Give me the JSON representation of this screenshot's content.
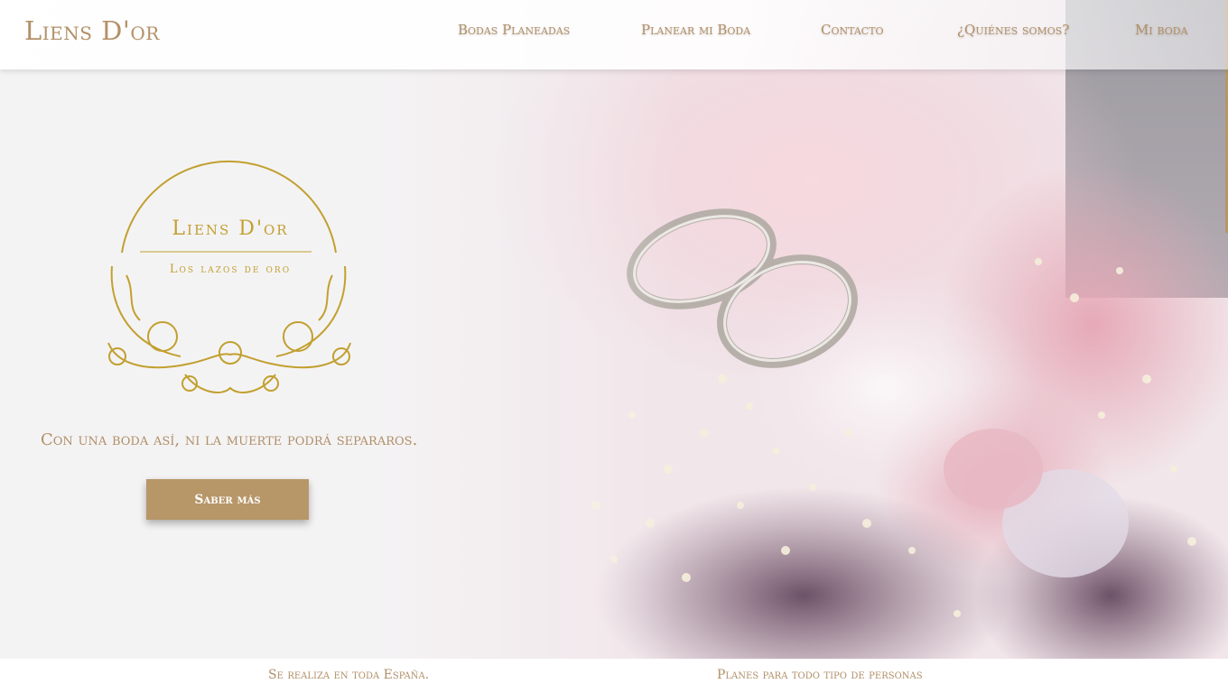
{
  "brand": {
    "name": "Liens D'or"
  },
  "nav": [
    {
      "label": "Bodas Planeadas"
    },
    {
      "label": "Planear mi Boda"
    },
    {
      "label": "Contacto"
    },
    {
      "label": "¿Quiénes somos?"
    },
    {
      "label": "Mi boda"
    }
  ],
  "hero": {
    "logo_line1": "Liens D'or",
    "logo_line2": "Los lazos de oro",
    "tagline": "Con una boda así, ni la muerte podrá separaros.",
    "cta_label": "Saber más"
  },
  "features": [
    {
      "text": "Se realiza en toda España."
    },
    {
      "text": "Planes para todo tipo de personas"
    }
  ],
  "colors": {
    "accent": "#b79668",
    "logo_gold": "#c2a030",
    "text_gold": "#b08f68"
  }
}
